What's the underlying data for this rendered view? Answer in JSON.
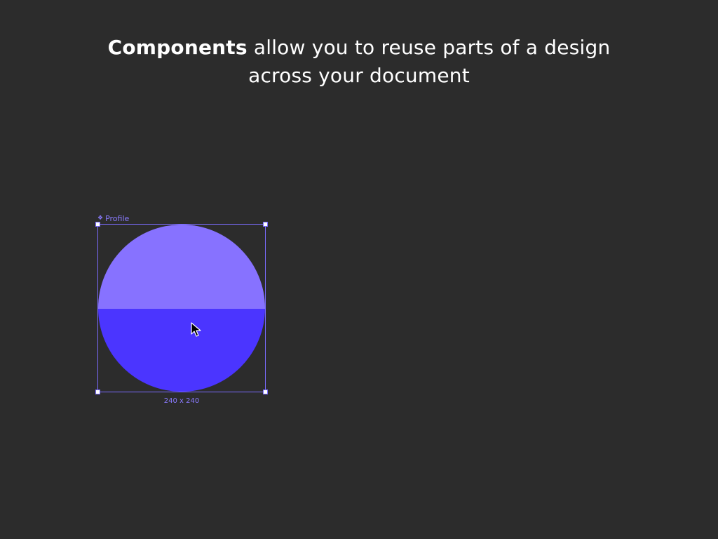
{
  "headline": {
    "bold": "Components",
    "rest_line1": " allow you to reuse parts of a design",
    "line2": "across your document"
  },
  "component": {
    "label": "Profile",
    "icon": "component-diamond-icon",
    "dimensions": "240 x 240",
    "colors": {
      "top_half": "#8772ff",
      "bottom_half": "#4b35ff",
      "selection": "#7b6cff"
    }
  },
  "cursor": {
    "icon": "arrow-pointer-icon"
  }
}
